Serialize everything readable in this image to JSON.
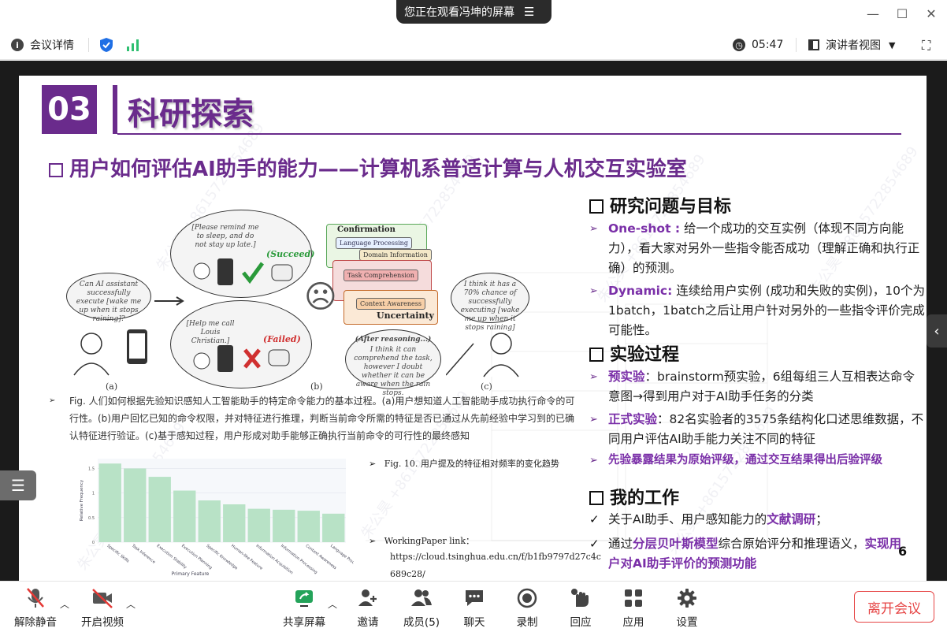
{
  "window": {
    "sharing_banner": "您正在观看冯坤的屏幕",
    "minimize": "—",
    "maximize": "☐",
    "close": "✕"
  },
  "infobar": {
    "meeting_details": "会议详情",
    "timer": "05:47",
    "view_mode": "演讲者视图"
  },
  "slide": {
    "section_number": "03",
    "section_title": "科研探索",
    "subtitle": "用户如何评估AI助手的能力——计算机系普适计算与人机交互实验室",
    "watermark": "朱公昊 +8615722854689",
    "figure": {
      "bubble1": "Can AI assistant successfully execute [wake me up when it stops raining]?",
      "bubble2": "[Please remind me to sleep, and do not stay up late.]",
      "succeed": "(Succeed)",
      "bubble3": "[Help me call Louis Christian.]",
      "failed": "(Failed)",
      "confirmation": "Confirmation",
      "lang_proc": "Language Processing",
      "domain_info": "Domain Information",
      "task_comp": "Task Comprehension",
      "context_aw": "Context Awareness",
      "uncertainty": "Uncertainty",
      "after_reasoning": "(After reasoning...)",
      "bubble4": "I think it can comprehend the task, however I doubt whether it can be aware when the rain stops.",
      "bubble5": "I think it has a 70% chance of successfully executing [wake me up when it stops raining]",
      "label_a": "(a)",
      "label_b": "(b)",
      "label_c": "(c)"
    },
    "fig9_caption": "Fig. 人们如何根据先验知识感知人工智能助手的特定命令能力的基本过程。(a)用户想知道人工智能助手成功执行命令的可行性。(b)用户回忆已知的命令权限，并对特征进行推理，判断当前命令所需的特征是否已通过从先前经验中学习到的已确认特征进行验证。(c)基于感知过程，用户形成对助手能够正确执行当前命令的可行性的最终感知",
    "fig10_caption": "Fig. 10. 用户提及的特征相对频率的变化趋势",
    "working_paper_label": "WorkingPaper link：",
    "working_paper_url_1": "https://cloud.tsinghua.edu.cn/f/b1fb9797d27c4c",
    "working_paper_url_2": "689c28/",
    "chart_data": {
      "type": "bar",
      "categories": [
        "Specific Skills",
        "Task Inference",
        "Execution Stability",
        "Execution Planning",
        "Specific Knowledge",
        "Human-like Feature",
        "Information Acquisition",
        "Information Processing",
        "Context Awareness",
        "Language Processing"
      ],
      "values": [
        1.6,
        1.5,
        1.33,
        1.05,
        0.85,
        0.77,
        0.68,
        0.66,
        0.64,
        0.58
      ],
      "title": "",
      "xlabel": "Primary Feature",
      "ylabel": "Relative Frequency",
      "ylim": [
        0,
        1.7
      ],
      "yticks": [
        "0",
        "0.5",
        "1",
        "1.5"
      ],
      "bar_color": "#b8e2c6"
    },
    "right": {
      "h1": "研究问题与目标",
      "oneshot_label": "One-shot :",
      "oneshot_text": "给一个成功的交互实例（体现不同方向能力），看大家对另外一些指令能否成功（理解正确和执行正确）的预测。",
      "dynamic_label": "Dynamic:",
      "dynamic_text": "连续给用户实例 (成功和失败的实例)，10个为1batch，1batch之后让用户针对另外的一些指令评价完成可能性。",
      "h2": "实验过程",
      "pre_label": "预实验",
      "pre_text": "：brainstorm预实验，6组每组三人互相表达命令意图→得到用户对于AI助手任务的分类",
      "formal_label": "正式实验",
      "formal_text": "：82名实验者的3575条结构化口述思维数据，不同用户评估AI助手能力关注不同的特征",
      "conclusion": "先验暴露结果为原始评级，通过交互结果得出后验评级",
      "h3": "我的工作",
      "work1_a": "关于AI助手、用户感知能力的",
      "work1_b": "文献调研",
      "work1_c": "；",
      "work2_a": "通过",
      "work2_b": "分层贝叶斯模型",
      "work2_c": "综合原始评分和推理语义，",
      "work2_d": "实现用户对AI助手评价的预测功能",
      "page_number": "6"
    },
    "accent_color": "#6a2b8c"
  },
  "toolbar": {
    "unmute": "解除静音",
    "start_video": "开启视频",
    "share_screen": "共享屏幕",
    "invite": "邀请",
    "members": "成员(5)",
    "chat": "聊天",
    "record": "录制",
    "reactions": "回应",
    "apps": "应用",
    "settings": "设置",
    "leave": "离开会议"
  }
}
